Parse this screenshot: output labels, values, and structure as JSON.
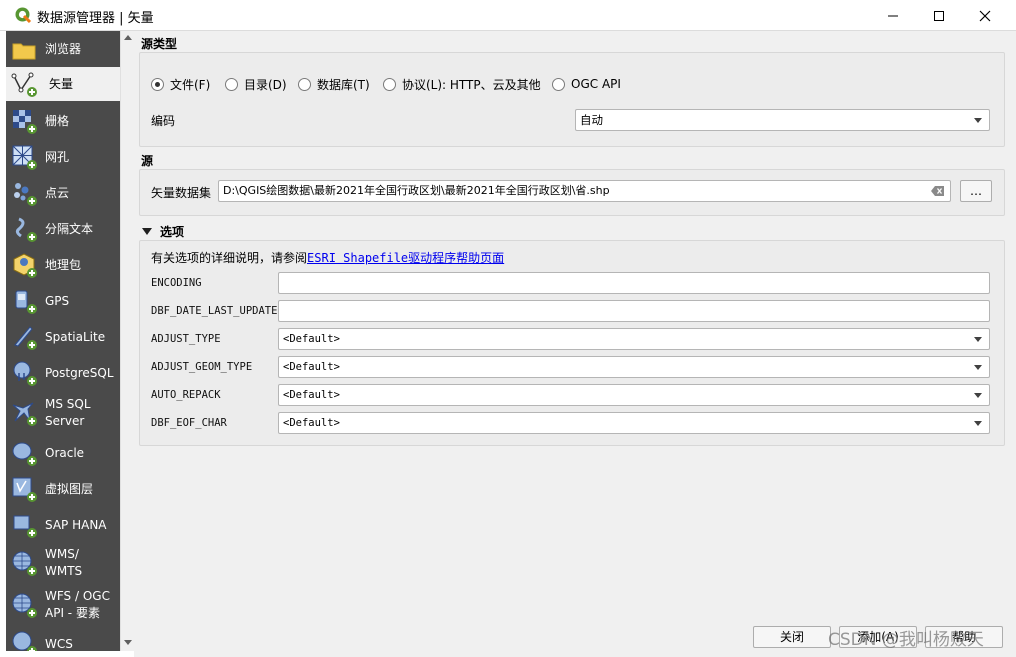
{
  "window": {
    "title": "数据源管理器 | 矢量",
    "minimize_icon": "minimize-icon",
    "maximize_icon": "maximize-icon",
    "close_icon": "close-icon"
  },
  "sidebar": {
    "items": [
      {
        "label": "浏览器",
        "icon": "folder-icon",
        "selected": false
      },
      {
        "label": "矢量",
        "icon": "vector-icon",
        "selected": true
      },
      {
        "label": "栅格",
        "icon": "raster-icon",
        "selected": false
      },
      {
        "label": "网孔",
        "icon": "mesh-icon",
        "selected": false
      },
      {
        "label": "点云",
        "icon": "point-cloud-icon",
        "selected": false
      },
      {
        "label": "分隔文本",
        "icon": "delimited-text-icon",
        "selected": false
      },
      {
        "label": "地理包",
        "icon": "geopackage-icon",
        "selected": false
      },
      {
        "label": "GPS",
        "icon": "gps-icon",
        "selected": false
      },
      {
        "label": "SpatiaLite",
        "icon": "spatialite-icon",
        "selected": false
      },
      {
        "label": "PostgreSQL",
        "icon": "postgresql-icon",
        "selected": false
      },
      {
        "label": "MS SQL\nServer",
        "icon": "mssql-icon",
        "selected": false
      },
      {
        "label": "Oracle",
        "icon": "oracle-icon",
        "selected": false
      },
      {
        "label": "虚拟图层",
        "icon": "virtual-layer-icon",
        "selected": false
      },
      {
        "label": "SAP HANA",
        "icon": "sap-hana-icon",
        "selected": false
      },
      {
        "label": "WMS/\nWMTS",
        "icon": "wms-icon",
        "selected": false
      },
      {
        "label": "WFS / OGC\nAPI - 要素",
        "icon": "wfs-icon",
        "selected": false
      },
      {
        "label": "WCS",
        "icon": "wcs-icon",
        "selected": false
      }
    ]
  },
  "source_type": {
    "title": "源类型",
    "radios": [
      {
        "label": "文件(F)",
        "checked": true
      },
      {
        "label": "目录(D)",
        "checked": false
      },
      {
        "label": "数据库(T)",
        "checked": false
      },
      {
        "label": "协议(L): HTTP、云及其他",
        "checked": false
      },
      {
        "label": "OGC API",
        "checked": false
      }
    ],
    "encoding_label": "编码",
    "encoding_value": "自动"
  },
  "source": {
    "title": "源",
    "dataset_label": "矢量数据集",
    "dataset_value": "D:\\QGIS绘图数据\\最新2021年全国行政区划\\最新2021年全国行政区划\\省.shp",
    "browse_label": "…",
    "clear_icon": "clear-icon"
  },
  "options": {
    "title": "选项",
    "help_prefix": "有关选项的详细说明，请参阅",
    "help_link": "ESRI Shapefile驱动程序帮助页面",
    "fields": [
      {
        "label": "ENCODING",
        "type": "text",
        "value": ""
      },
      {
        "label": "DBF_DATE_LAST_UPDATE",
        "type": "text",
        "value": ""
      },
      {
        "label": "ADJUST_TYPE",
        "type": "combo",
        "value": "<Default>"
      },
      {
        "label": "ADJUST_GEOM_TYPE",
        "type": "combo",
        "value": "<Default>"
      },
      {
        "label": "AUTO_REPACK",
        "type": "combo",
        "value": "<Default>"
      },
      {
        "label": "DBF_EOF_CHAR",
        "type": "combo",
        "value": "<Default>"
      }
    ]
  },
  "footer": {
    "close_label": "关闭",
    "add_label": "添加(A)",
    "help_label": "帮助"
  },
  "watermark": "CSDN @我叫杨败天"
}
